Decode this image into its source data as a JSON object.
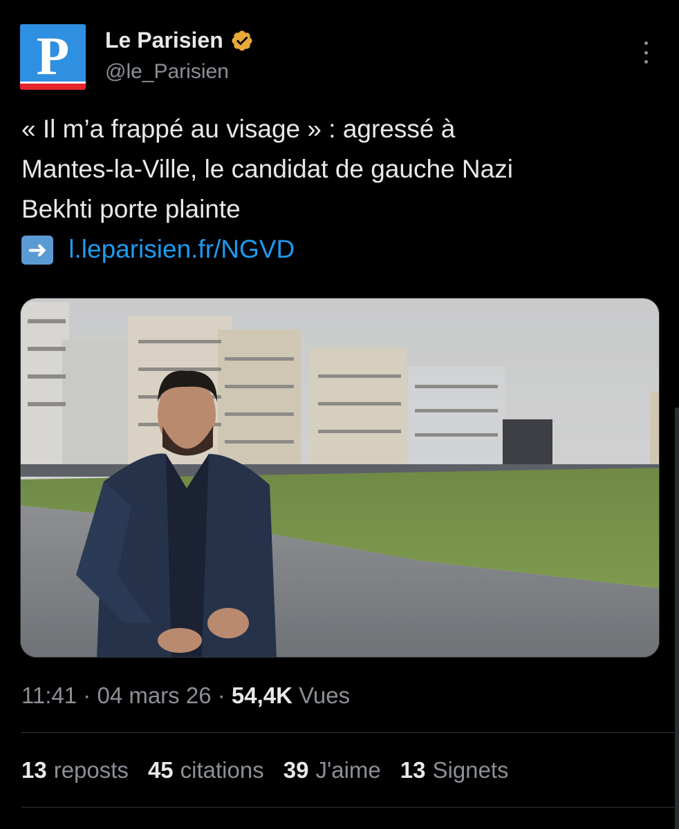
{
  "account": {
    "name": "Le Parisien",
    "handle": "@le_Parisien",
    "avatar_letter": "P",
    "avatar_color": "#2f8fe0",
    "avatar_accent": "#e4262b",
    "verified_badge_color": "#e8a93a",
    "verified_icon": "verified-badge-icon"
  },
  "tweet": {
    "lines": [
      "« Il m’a frappé au visage » : agressé à",
      "Mantes-la-Ville, le candidat de gauche Nazi",
      "Bekhti porte plainte"
    ],
    "link_emoji": "➡️",
    "link_text": "l.leparisien.fr/NGVD",
    "link_color": "#1d9bf0"
  },
  "media": {
    "type": "photo",
    "icon": "photo-icon"
  },
  "meta": {
    "time": "11:41",
    "separator": " · ",
    "date": "04 mars 26",
    "views_count": "54,4K",
    "views_label": "Vues"
  },
  "stats": [
    {
      "count": "13",
      "label": "reposts"
    },
    {
      "count": "45",
      "label": "citations"
    },
    {
      "count": "39",
      "label": "J'aime"
    },
    {
      "count": "13",
      "label": "Signets"
    }
  ],
  "theme": {
    "background": "#000000",
    "text_primary": "#e7e9ea",
    "text_secondary": "#8b9096",
    "divider": "#2f3336"
  }
}
